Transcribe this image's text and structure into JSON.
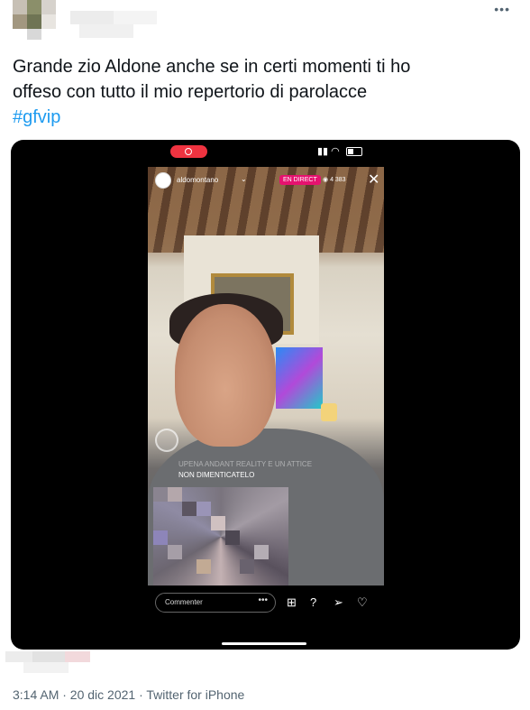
{
  "tweet": {
    "more_label": "•••",
    "text_line1": "Grande zio Aldone anche se in certi momenti ti ho",
    "text_line2": "offeso con tutto il mio repertorio di parolacce",
    "hashtag": "#gfvip",
    "timestamp": "3:14 AM · 20 dic 2021 · Twitter for iPhone"
  },
  "media": {
    "live": {
      "username": "aldomontano",
      "badge": "EN DIRECT",
      "viewers": "4 383",
      "caption_faded": "UPENA ANDANT REALITY E UN ATTICE",
      "caption": "NON DIMENTICATELO",
      "comment_placeholder": "Commenter",
      "comment_dots": "•••"
    }
  },
  "colors": {
    "text": "#0f1419",
    "secondary": "#536471",
    "link": "#1d9bf0",
    "live_badge": "#e5126f",
    "recording": "#ef3340"
  },
  "icons": [
    "more-icon",
    "recording-icon",
    "signal-icon",
    "wifi-icon",
    "battery-icon",
    "close-icon",
    "viewers-icon",
    "add-icon",
    "question-icon",
    "share-icon",
    "heart-icon"
  ]
}
